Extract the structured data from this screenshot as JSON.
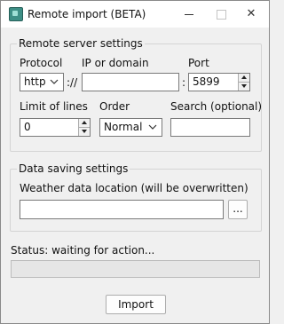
{
  "window": {
    "title": "Remote import (BETA)",
    "controls": {
      "minimize": "–",
      "maximize": "□",
      "close": "✕"
    }
  },
  "server": {
    "legend": "Remote server settings",
    "protocol_label": "Protocol",
    "protocol_value": "http",
    "scheme_sep": "://",
    "domain_label": "IP or domain",
    "domain_value": "",
    "port_sep": ":",
    "port_label": "Port",
    "port_value": "5899",
    "limit_label": "Limit of lines",
    "limit_value": "0",
    "order_label": "Order",
    "order_value": "Normal",
    "search_label": "Search (optional)",
    "search_value": ""
  },
  "saving": {
    "legend": "Data saving settings",
    "location_label": "Weather data location (will be overwritten)",
    "location_value": "",
    "browse_label": "..."
  },
  "status": {
    "text": "Status: waiting for action...",
    "progress": 0
  },
  "actions": {
    "import_label": "Import"
  }
}
